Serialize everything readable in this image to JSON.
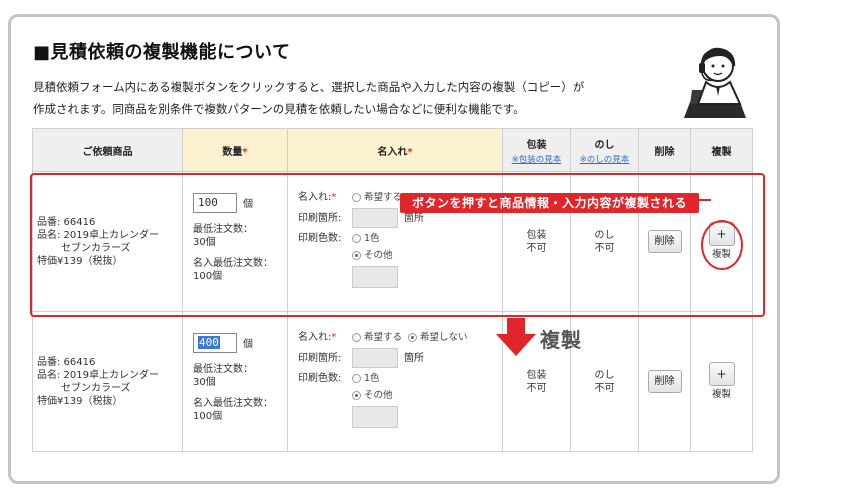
{
  "heading": "■見積依頼の複製機能について",
  "description": {
    "line1": "見積依頼フォーム内にある複製ボタンをクリックすると、選択した商品や入力した内容の複製（コピー）が",
    "line2": "作成されます。同商品を別条件で複数パターンの見積を依頼したい場合などに便利な機能です。"
  },
  "table": {
    "headers": {
      "product": "ご依頼商品",
      "quantity": "数量",
      "name_print": "名入れ",
      "required_mark": "*",
      "wrapping": "包装",
      "wrapping_link": "※包装の見本",
      "noshi": "のし",
      "noshi_link": "※のしの見本",
      "delete": "削除",
      "copy": "複製"
    },
    "rows": [
      {
        "product_no": "品番: 66416",
        "product_name": "品名: 2019卓上カレンダー",
        "product_name2": "セブンカラーズ",
        "price": "特価¥139（税抜）",
        "qty_value": "100",
        "qty_unit": "個",
        "min_order_label": "最低注文数：",
        "min_order_value": "30個",
        "min_name_label": "名入最低注文数：",
        "min_name_value": "100個",
        "name_label": "名入れ:",
        "opt_want": "希望する",
        "opt_not_want": "",
        "print_place_label": "印刷箇所:",
        "print_place_unit": "箇所",
        "print_color_label": "印刷色数:",
        "opt_one_color": "1色",
        "opt_other": "その他",
        "wrapping_value": "包装",
        "wrapping_value2": "不可",
        "noshi_value": "のし",
        "noshi_value2": "不可",
        "delete_label": "削除",
        "copy_symbol": "+",
        "copy_label": "複製"
      },
      {
        "product_no": "品番: 66416",
        "product_name": "品名: 2019卓上カレンダー",
        "product_name2": "セブンカラーズ",
        "price": "特価¥139（税抜）",
        "qty_value": "400",
        "qty_unit": "個",
        "min_order_label": "最低注文数：",
        "min_order_value": "30個",
        "min_name_label": "名入最低注文数：",
        "min_name_value": "100個",
        "name_label": "名入れ:",
        "opt_want": "希望する",
        "opt_not_want": "希望しない",
        "print_place_label": "印刷箇所:",
        "print_place_unit": "箇所",
        "print_color_label": "印刷色数:",
        "opt_one_color": "1色",
        "opt_other": "その他",
        "wrapping_value": "包装",
        "wrapping_value2": "不可",
        "noshi_value": "のし",
        "noshi_value2": "不可",
        "delete_label": "削除",
        "copy_symbol": "+",
        "copy_label": "複製"
      }
    ]
  },
  "callout": {
    "banner": "ボタンを押すと商品情報・入力内容が複製される",
    "arrow_label": "複製"
  },
  "colors": {
    "accent_red": "#e0262a",
    "header_gray": "#efefef",
    "header_yellow": "#fdf2d0",
    "link_blue": "#2a6fcf"
  },
  "icons": {
    "operator": "headset-operator-icon",
    "arrow": "arrow-down-icon"
  }
}
